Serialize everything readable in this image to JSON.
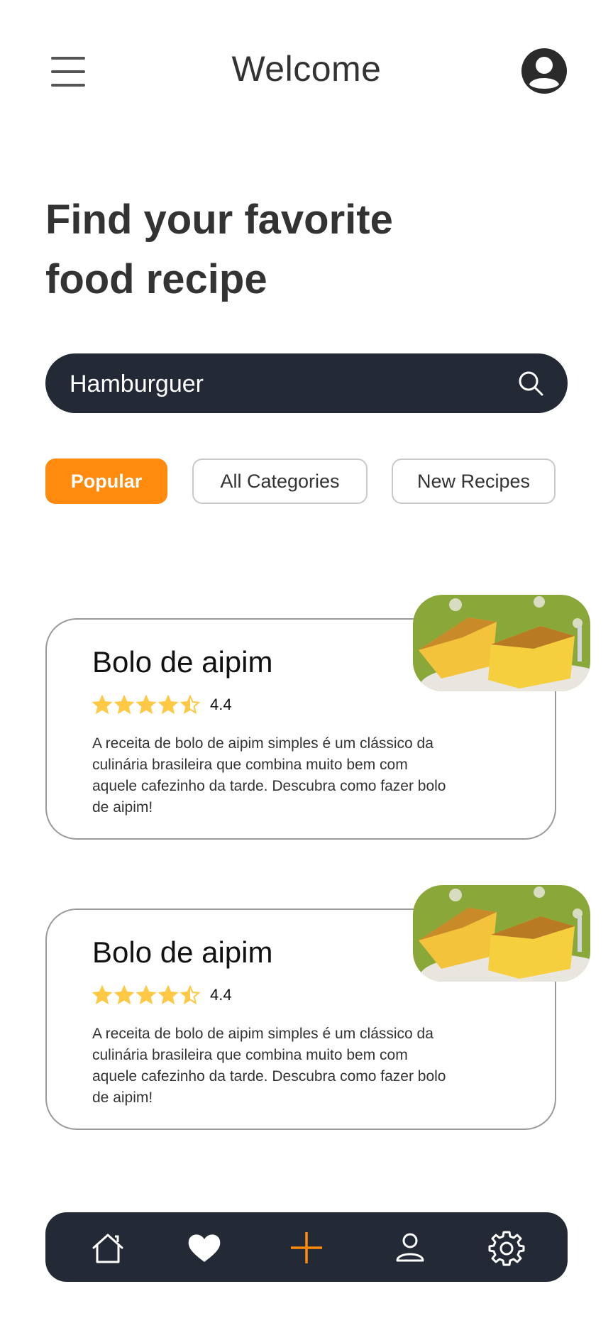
{
  "header": {
    "title": "Welcome"
  },
  "hero": {
    "line1": "Find your favorite",
    "line2": "food recipe"
  },
  "search": {
    "value": "Hamburguer",
    "placeholder": ""
  },
  "tabs": [
    {
      "label": "Popular",
      "active": true
    },
    {
      "label": "All Categories",
      "active": false
    },
    {
      "label": "New Recipes",
      "active": false
    }
  ],
  "recipes": [
    {
      "title": "Bolo de aipim",
      "rating": "4.4",
      "stars": 4.5,
      "description": "A receita de bolo de aipim simples é um clássico da culinária brasileira que combina muito bem com aquele cafezinho da tarde. Descubra como fazer bolo de aipim!"
    },
    {
      "title": "Bolo de aipim",
      "rating": "4.4",
      "stars": 4.5,
      "description": "A receita de bolo de aipim simples é um clássico da culinária brasileira que combina muito bem com aquele cafezinho da tarde. Descubra como fazer bolo de aipim!"
    }
  ],
  "bottom_nav": [
    "home-icon",
    "heart-icon",
    "plus-icon",
    "user-icon",
    "gear-icon"
  ],
  "colors": {
    "accent": "#ff8a0d",
    "dark": "#232a36",
    "star": "#ffc845",
    "text": "#333333"
  }
}
